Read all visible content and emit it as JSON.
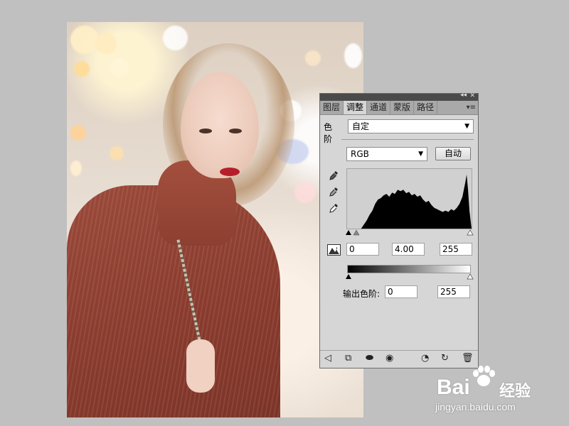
{
  "panel": {
    "tabs": [
      {
        "label": "图层"
      },
      {
        "label": "调整"
      },
      {
        "label": "通道"
      },
      {
        "label": "蒙版"
      },
      {
        "label": "路径"
      }
    ],
    "active_tab": "调整",
    "preset_label": "色阶",
    "preset_value": "自定",
    "channel_value": "RGB",
    "auto_label": "自动",
    "input_levels": {
      "black": "0",
      "gamma": "4.00",
      "white": "255"
    },
    "output_label": "输出色阶:",
    "output_levels": {
      "black": "0",
      "white": "255"
    }
  },
  "icons": {
    "tools": [
      "eyedropper-black-icon",
      "eyedropper-gray-icon",
      "eyedropper-white-icon",
      "clipping-warning-icon"
    ],
    "bottom": [
      "back-arrow-icon",
      "expand-view-icon",
      "clip-to-layer-icon",
      "visibility-eye-icon",
      "previous-state-icon",
      "reset-icon",
      "trash-icon"
    ]
  },
  "watermark": {
    "brand": "Bai",
    "brand_suffix": "经验",
    "url": "jingyan.baidu.com"
  }
}
